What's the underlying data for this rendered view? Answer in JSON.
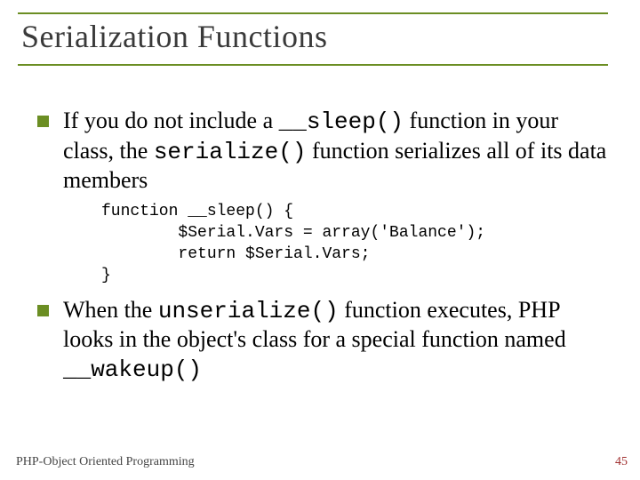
{
  "title": "Serialization Functions",
  "bullets": [
    {
      "pre": "If you do not include a ",
      "code1": "__sleep()",
      "mid1": " function in your class, the ",
      "code2": "serialize()",
      "post": " function serializes all of its data members"
    },
    {
      "pre": "When the ",
      "code1": "unserialize()",
      "mid1": " function executes, PHP looks in the object's class for a special function named ",
      "code2": "__wakeup()",
      "post": ""
    }
  ],
  "code": {
    "l1": "function __sleep() {",
    "l2": "        $Serial.Vars = array('Balance');",
    "l3": "        return $Serial.Vars;",
    "l4": "}"
  },
  "footer": {
    "left": "PHP-Object Oriented Programming",
    "right": "45"
  }
}
